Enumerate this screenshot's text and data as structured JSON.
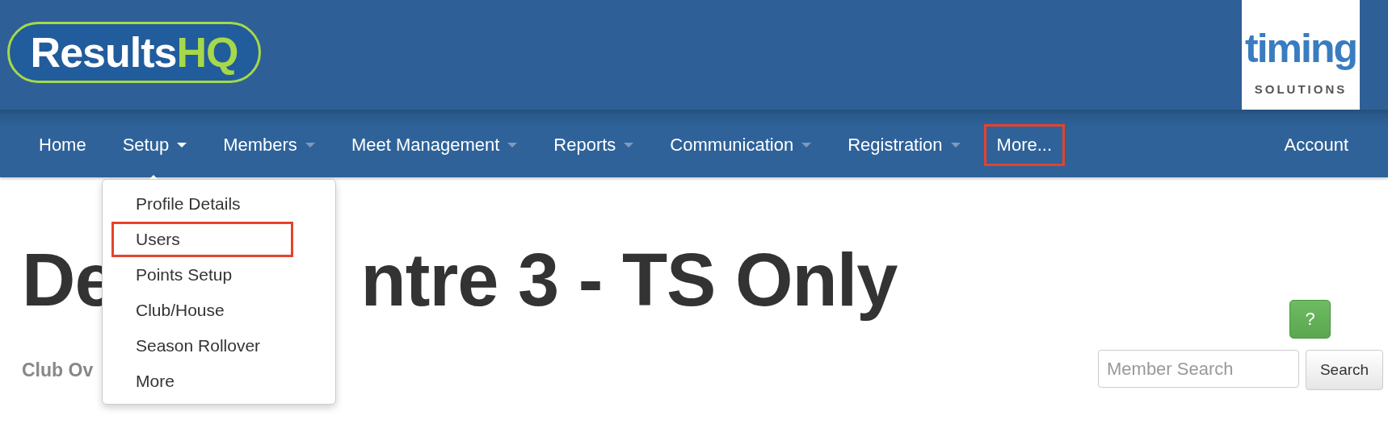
{
  "header": {
    "logo": {
      "word": "Results",
      "accent": "HQ"
    },
    "partner_logo": {
      "word": "timing",
      "tagline": "SOLUTIONS"
    }
  },
  "nav": {
    "items": [
      {
        "label": "Home",
        "has_menu": false,
        "expanded": false,
        "highlighted": false
      },
      {
        "label": "Setup",
        "has_menu": true,
        "expanded": true,
        "highlighted": false
      },
      {
        "label": "Members",
        "has_menu": true,
        "expanded": false,
        "highlighted": false
      },
      {
        "label": "Meet Management",
        "has_menu": true,
        "expanded": false,
        "highlighted": false
      },
      {
        "label": "Reports",
        "has_menu": true,
        "expanded": false,
        "highlighted": false
      },
      {
        "label": "Communication",
        "has_menu": true,
        "expanded": false,
        "highlighted": false
      },
      {
        "label": "Registration",
        "has_menu": true,
        "expanded": false,
        "highlighted": false
      },
      {
        "label": "More...",
        "has_menu": false,
        "expanded": false,
        "highlighted": true
      }
    ],
    "account": "Account"
  },
  "dropdown": {
    "items": [
      {
        "label": "Profile Details",
        "highlighted": false
      },
      {
        "label": "Users",
        "highlighted": true
      },
      {
        "label": "Points Setup",
        "highlighted": false
      },
      {
        "label": "Club/House",
        "highlighted": false
      },
      {
        "label": "Season Rollover",
        "highlighted": false
      },
      {
        "label": "More",
        "highlighted": false
      }
    ]
  },
  "page": {
    "title_parts": [
      "De",
      "ntre 3 - TS Only"
    ],
    "subtitle": "Club Ov",
    "help_button": "?",
    "search": {
      "placeholder": "Member Search",
      "button": "Search"
    }
  }
}
